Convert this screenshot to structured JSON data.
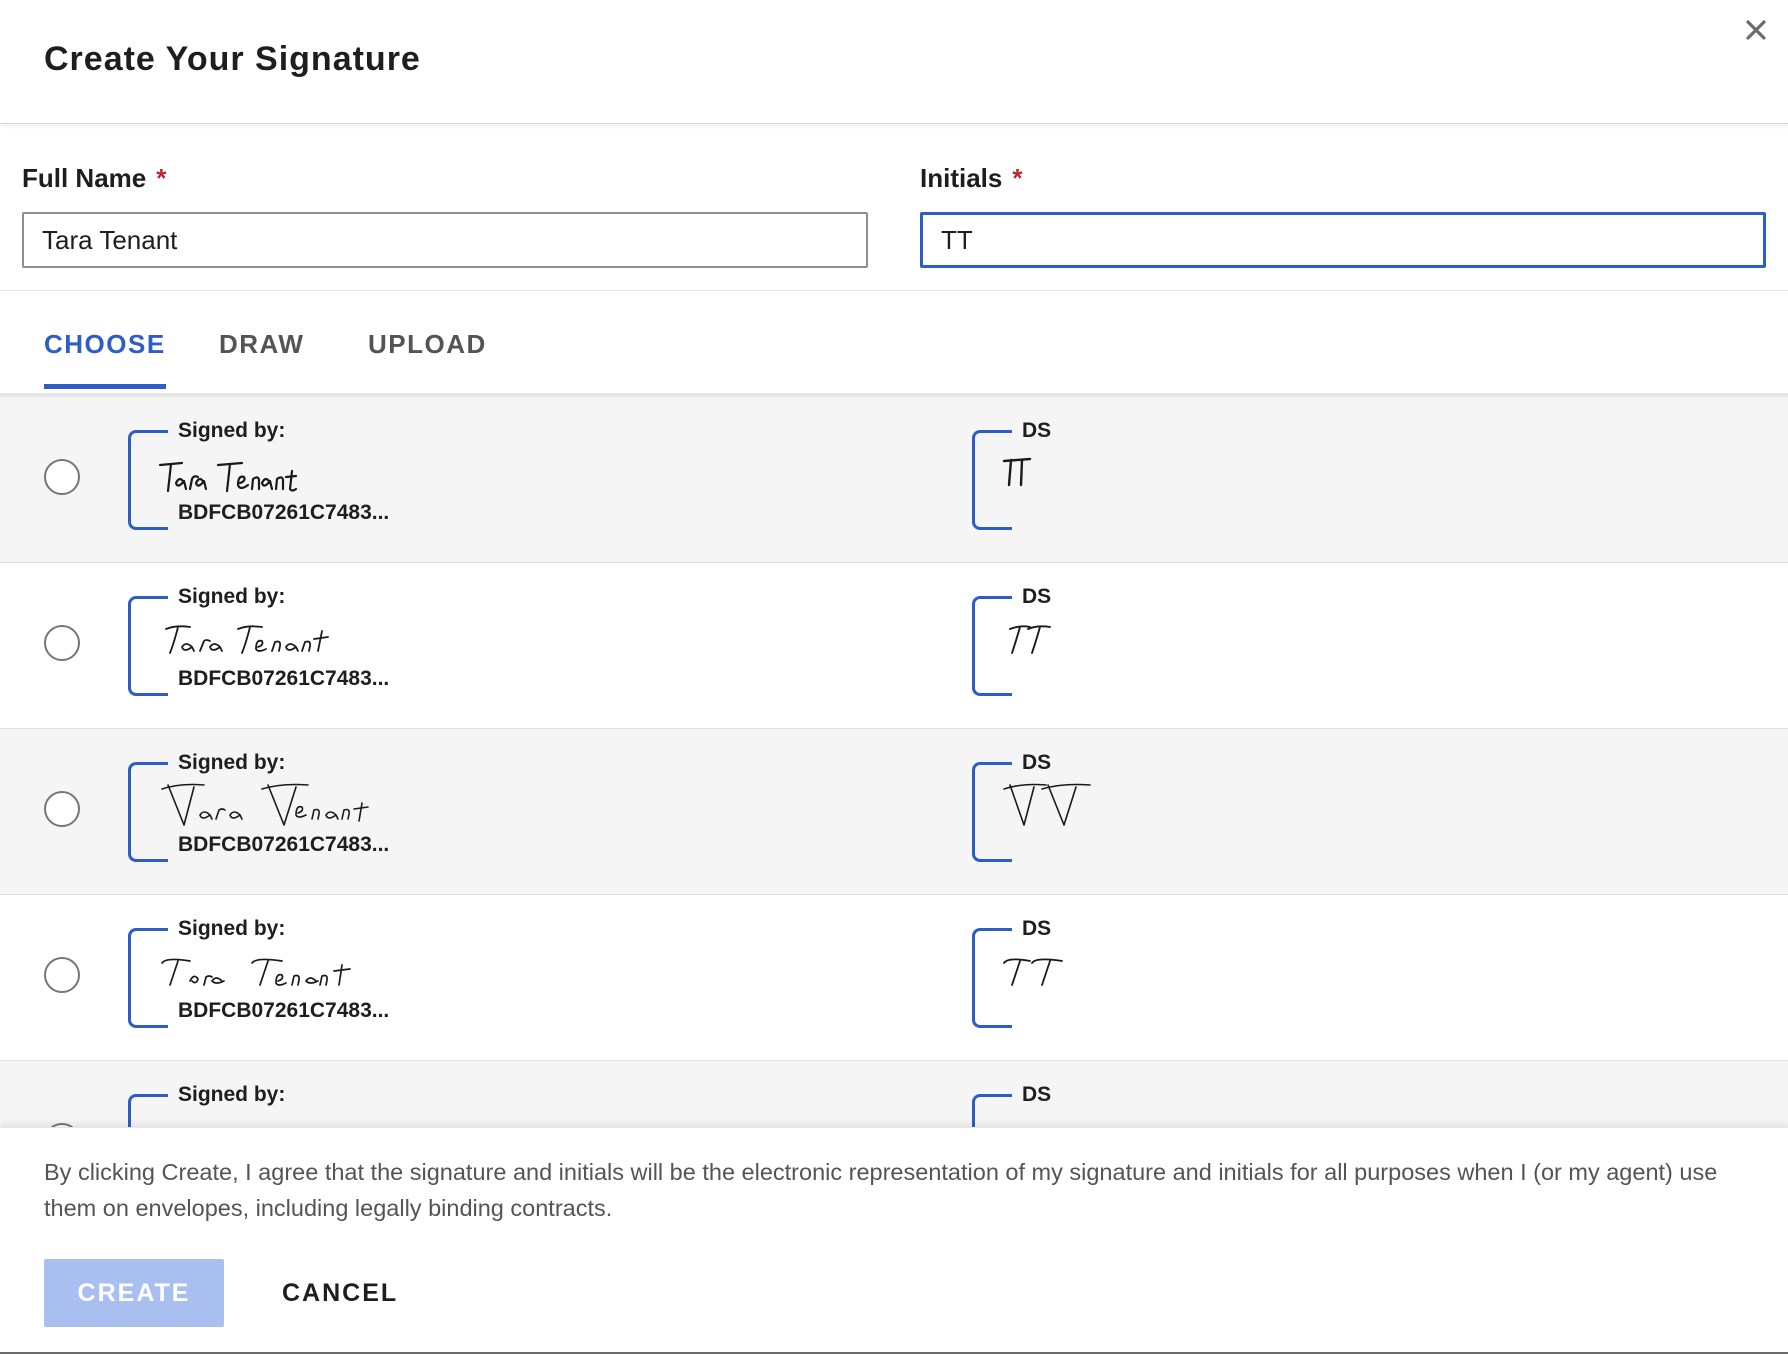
{
  "dialog": {
    "title": "Create Your Signature",
    "close_icon": "close-icon"
  },
  "fields": {
    "full_name": {
      "label": "Full Name",
      "required": "*",
      "value": "Tara Tenant"
    },
    "initials": {
      "label": "Initials",
      "required": "*",
      "value": "TT"
    }
  },
  "tabs": [
    {
      "label": "CHOOSE",
      "active": true
    },
    {
      "label": "DRAW",
      "active": false
    },
    {
      "label": "UPLOAD",
      "active": false
    }
  ],
  "options": [
    {
      "signed_label": "Signed by:",
      "signature": "Tara Tenant",
      "cert_id": "BDFCB07261C7483...",
      "ds_label": "DS",
      "initials": "TT",
      "selected": false
    },
    {
      "signed_label": "Signed by:",
      "signature": "Tara Tenant",
      "cert_id": "BDFCB07261C7483...",
      "ds_label": "DS",
      "initials": "TT",
      "selected": false
    },
    {
      "signed_label": "Signed by:",
      "signature": "Tara Tenant",
      "cert_id": "BDFCB07261C7483...",
      "ds_label": "DS",
      "initials": "TT",
      "selected": false
    },
    {
      "signed_label": "Signed by:",
      "signature": "Tara Tenant",
      "cert_id": "BDFCB07261C7483...",
      "ds_label": "DS",
      "initials": "TT",
      "selected": false
    },
    {
      "signed_label": "Signed by:",
      "signature": "",
      "cert_id": "",
      "ds_label": "DS",
      "initials": "",
      "selected": false
    }
  ],
  "footer": {
    "agreement": "By clicking Create, I agree that the signature and initials will be the electronic representation of my signature and initials for all purposes when I (or my agent) use them on envelopes, including legally binding contracts.",
    "create_label": "CREATE",
    "cancel_label": "CANCEL"
  },
  "colors": {
    "accent": "#2c5ec6",
    "required": "#c2232f",
    "create_disabled": "#a9bff0",
    "row_shade": "#f5f5f5"
  }
}
